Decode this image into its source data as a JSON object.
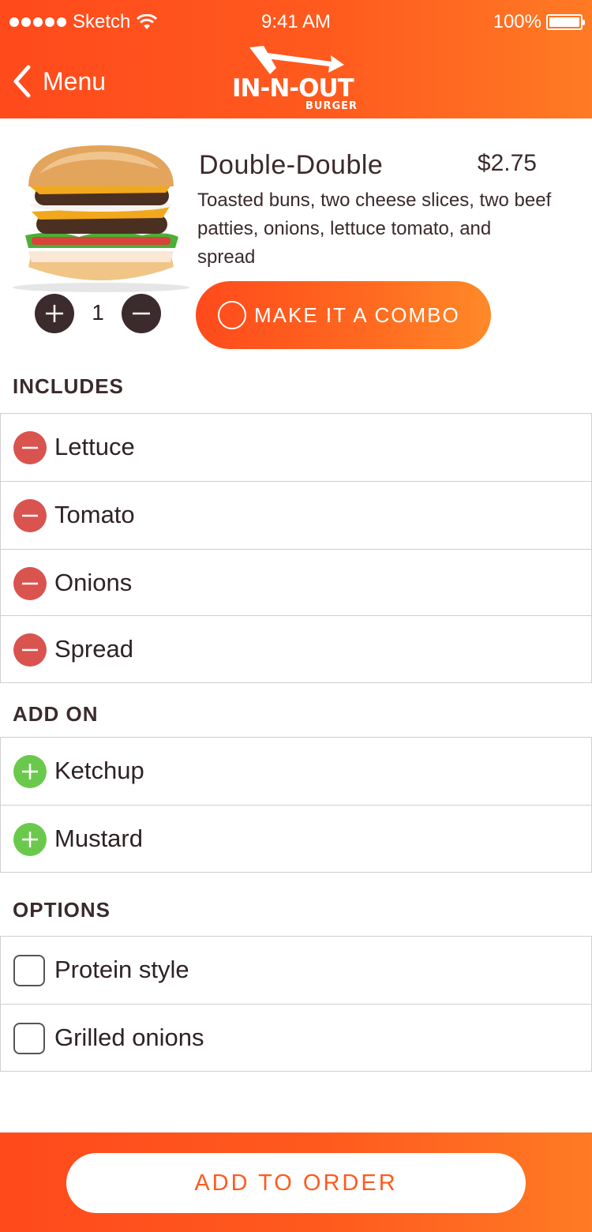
{
  "status_bar": {
    "carrier": "Sketch",
    "time": "9:41 AM",
    "battery": "100%"
  },
  "nav": {
    "back_label": "Menu",
    "logo_line1": "IN-N-OUT",
    "logo_line2": "BURGER"
  },
  "product": {
    "name": "Double-Double",
    "price": "$2.75",
    "description": "Toasted buns, two cheese slices, two beef patties, onions, lettuce tomato, and spread",
    "quantity": "1",
    "combo_label": "MAKE IT A COMBO"
  },
  "includes": {
    "heading": "INCLUDES",
    "items": [
      "Lettuce",
      "Tomato",
      "Onions",
      "Spread"
    ]
  },
  "add_on": {
    "heading": "ADD ON",
    "items": [
      "Ketchup",
      "Mustard"
    ]
  },
  "options": {
    "heading": "OPTIONS",
    "items": [
      "Protein style",
      "Grilled onions"
    ]
  },
  "footer": {
    "add_to_order_label": "ADD TO ORDER"
  },
  "colors": {
    "brand_orange": "#ff5a1e",
    "remove_red": "#d9534f",
    "add_green": "#6ac94c",
    "dark_brown": "#3b2a2c"
  }
}
